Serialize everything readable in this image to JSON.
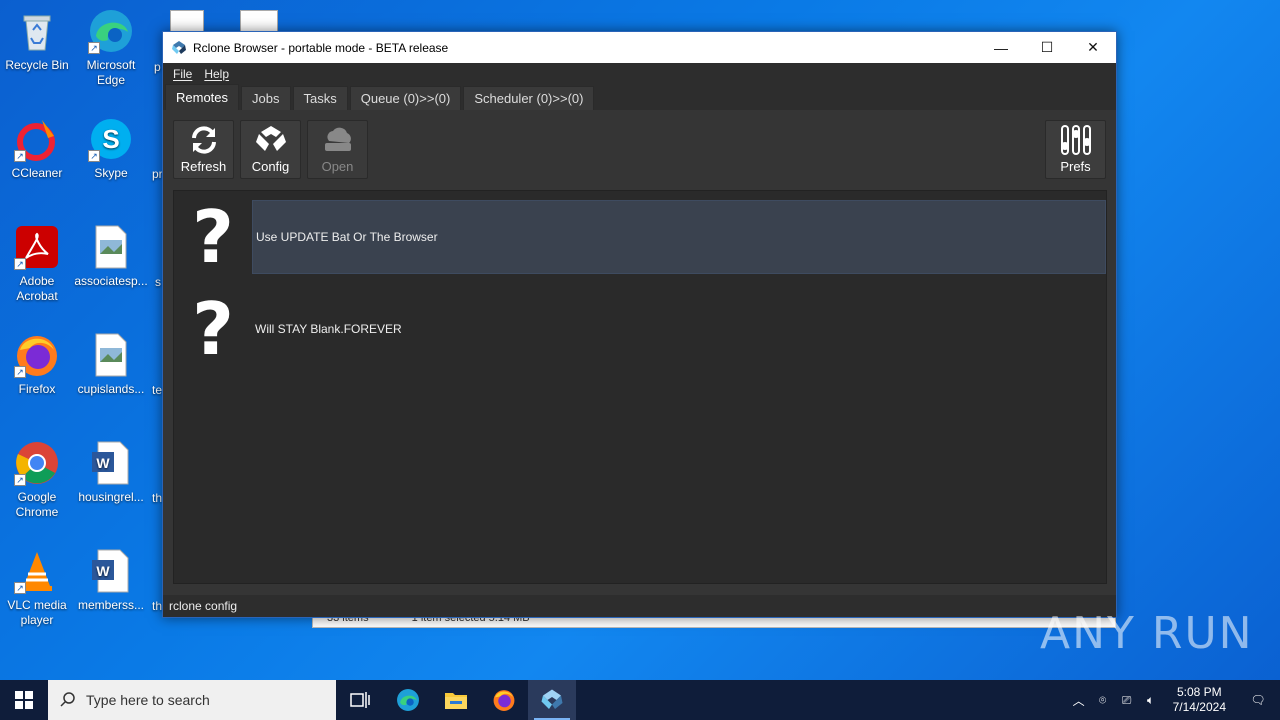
{
  "desktop": {
    "icons": [
      {
        "label": "Recycle Bin"
      },
      {
        "label": "Microsoft Edge"
      },
      {
        "label": "CCleaner"
      },
      {
        "label": "Skype"
      },
      {
        "label": "Adobe Acrobat"
      },
      {
        "label": "associatesp..."
      },
      {
        "label": "Firefox"
      },
      {
        "label": "cupislands..."
      },
      {
        "label": "Google Chrome"
      },
      {
        "label": "housingrel..."
      },
      {
        "label": "VLC media player"
      },
      {
        "label": "memberss..."
      }
    ],
    "partials": [
      "p",
      "pr",
      "s",
      "te",
      "th",
      "th"
    ]
  },
  "explorer_strip": {
    "items": "33 items",
    "selected": "1 item selected 5.14 MB"
  },
  "window": {
    "title": "Rclone Browser - portable mode - BETA release",
    "menu": [
      "File",
      "Help"
    ],
    "tabs": [
      "Remotes",
      "Jobs",
      "Tasks",
      "Queue (0)>>(0)",
      "Scheduler (0)>>(0)"
    ],
    "toolbar": {
      "refresh": "Refresh",
      "config": "Config",
      "open": "Open",
      "prefs": "Prefs"
    },
    "remotes": [
      {
        "label": "Use UPDATE Bat Or The Browser",
        "selected": true
      },
      {
        "label": "Will STAY Blank.FOREVER",
        "selected": false
      }
    ],
    "status": "rclone config"
  },
  "taskbar": {
    "search_placeholder": "Type here to search",
    "time": "5:08 PM",
    "date": "7/14/2024"
  },
  "watermark": "ANY RUN"
}
